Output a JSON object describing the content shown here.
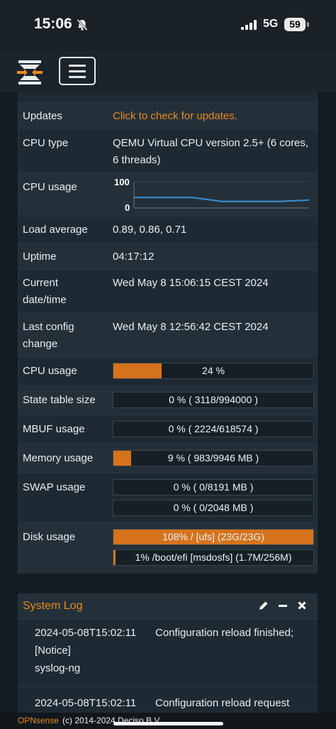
{
  "status_bar": {
    "time": "15:06",
    "network": "5G",
    "battery": "59"
  },
  "navbar": {
    "logo_icon": "opnsense-logo-icon",
    "menu_icon": "hamburger-menu-icon"
  },
  "system_info": {
    "rows": {
      "updates": {
        "label": "Updates",
        "value": "Click to check for updates."
      },
      "cpu_type": {
        "label": "CPU type",
        "value": "QEMU Virtual CPU version 2.5+ (6 cores, 6 threads)"
      },
      "cpu_graph": {
        "label": "CPU usage",
        "y_max": "100",
        "y_min": "0"
      },
      "load_average": {
        "label": "Load average",
        "value": "0.89, 0.86, 0.71"
      },
      "uptime": {
        "label": "Uptime",
        "value": "04:17:12"
      },
      "current_time": {
        "label": "Current date/time",
        "value": "Wed May 8 15:06:15 CEST 2024"
      },
      "last_config": {
        "label": "Last config change",
        "value": "Wed May 8 12:56:42 CEST 2024"
      },
      "cpu_bar": {
        "label": "CPU usage",
        "text": "24 %",
        "percent": 24
      },
      "state_table": {
        "label": "State table size",
        "text": "0 % ( 3118/994000 )",
        "percent": 0
      },
      "mbuf": {
        "label": "MBUF usage",
        "text": "0 % ( 2224/618574 )",
        "percent": 0
      },
      "memory": {
        "label": "Memory usage",
        "text": "9 % ( 983/9946 MB )",
        "percent": 9
      },
      "swap": {
        "label": "SWAP usage",
        "bars": [
          {
            "text": "0 % ( 0/8191 MB )",
            "percent": 0
          },
          {
            "text": "0 % ( 0/2048 MB )",
            "percent": 0
          }
        ]
      },
      "disk": {
        "label": "Disk usage",
        "bars": [
          {
            "text": "108% / [ufs] (23G/23G)",
            "percent": 100
          },
          {
            "text": "1% /boot/efi [msdosfs] (1.7M/256M)",
            "percent": 1
          }
        ]
      }
    },
    "cpu_graph_data": {
      "y_range": [
        0,
        100
      ],
      "values": [
        40,
        40,
        40,
        25,
        25,
        25,
        30
      ]
    }
  },
  "system_log": {
    "title": "System Log",
    "icons": {
      "edit": "pencil-icon",
      "minimize": "minus-icon",
      "close": "close-icon"
    },
    "entries": [
      {
        "timestamp": "2024-05-08T15:02:11",
        "level": "[Notice]",
        "source": "syslog-ng",
        "message": "Configuration reload finished;"
      },
      {
        "timestamp": "2024-05-08T15:02:11",
        "message": "Configuration reload request"
      }
    ]
  },
  "footer": {
    "brand": "OPNsense",
    "copyright": "(c) 2014-2024 Deciso B.V."
  },
  "colors": {
    "accent": "#e88a1e",
    "bar_fill": "#d5731c",
    "graph_line": "#3a8fd6",
    "panel_bg": "#1e2a33",
    "page_bg": "#141b21"
  }
}
